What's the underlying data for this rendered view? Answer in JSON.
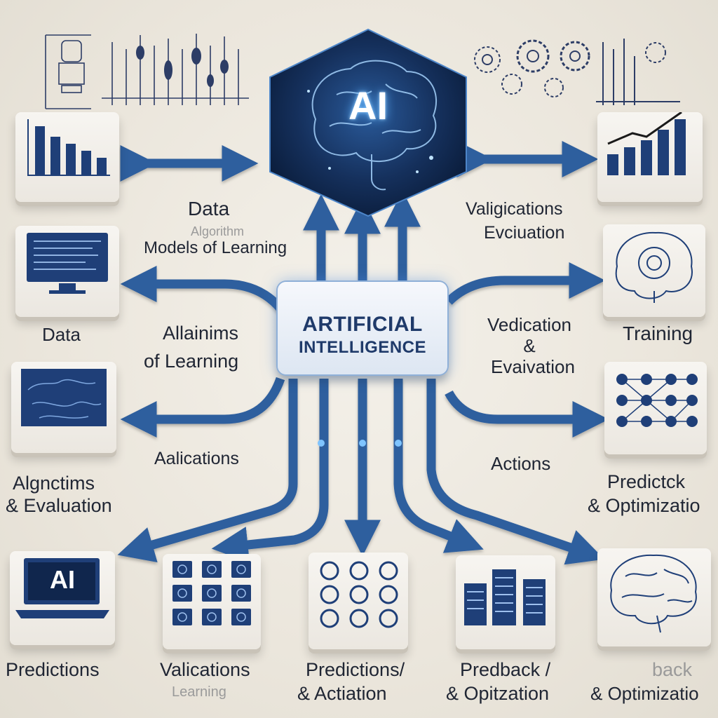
{
  "hub": {
    "label": "AI"
  },
  "center": {
    "line1": "ARTIFICIAL",
    "line2": "INTELLIGENCE"
  },
  "screen_tile": {
    "label": "AI"
  },
  "labels": {
    "data_top": "Data",
    "faint_under_data": "Algorithm",
    "models_of_learning": "Models of Learning",
    "valigications": "Valigications",
    "evciuation": "Evciuation",
    "data_left": "Data",
    "allainims": "Allainims",
    "of_learning": "of Learning",
    "vedication": "Vedication",
    "ampersand": "&",
    "evaivation": "Evaivation",
    "training": "Training",
    "aalications": "Aalications",
    "actions": "Actions",
    "algnctims": "Algnctims",
    "and_evaluation": "& Evaluation",
    "predictck": "Predictck",
    "and_optimizatio": "& Optimizatio",
    "predictions_bottom": "Predictions",
    "valications_bottom": "Valications",
    "faint_learning": "Learning",
    "predictions_slash": "Predictions/",
    "and_actiation": "& Actiation",
    "predback": "Predback /",
    "and_opitzation": "& Opitzation",
    "faint_back": "back",
    "and_optimizatio_bottom": "& Optimizatio"
  },
  "colors": {
    "arrow": "#2f5f9e",
    "arrow_dark": "#1d3f70",
    "icon": "#1f3f78",
    "hub_dark": "#0f2448",
    "glow": "#6fb8ff"
  },
  "icons": [
    "robot-sketch-icon",
    "gears-sketch-icon",
    "bar-chart-icon",
    "growth-chart-icon",
    "monitor-icon",
    "brain-gear-icon",
    "world-map-icon",
    "neural-network-icon",
    "laptop-icon",
    "grid-icons-icon",
    "circle-grid-icon",
    "server-racks-icon",
    "brain-icon"
  ]
}
